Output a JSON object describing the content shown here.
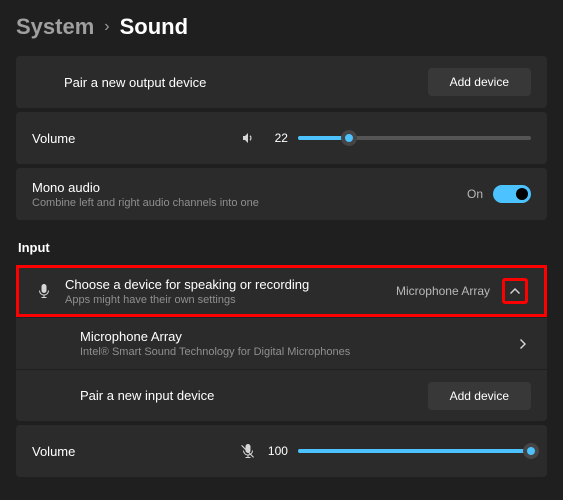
{
  "breadcrumb": {
    "parent": "System",
    "current": "Sound"
  },
  "output": {
    "pair_label": "Pair a new output device",
    "add_button": "Add device",
    "volume_label": "Volume",
    "volume_value": "22",
    "mono_title": "Mono audio",
    "mono_sub": "Combine left and right audio channels into one",
    "mono_state": "On"
  },
  "input_section_label": "Input",
  "input": {
    "choose_title": "Choose a device for speaking or recording",
    "choose_sub": "Apps might have their own settings",
    "selected_device": "Microphone Array",
    "device_name": "Microphone Array",
    "device_sub": "Intel® Smart Sound Technology for Digital Microphones",
    "pair_label": "Pair a new input device",
    "add_button": "Add device",
    "volume_label": "Volume",
    "volume_value": "100"
  },
  "slider": {
    "output_pct": 22,
    "input_pct": 100
  }
}
